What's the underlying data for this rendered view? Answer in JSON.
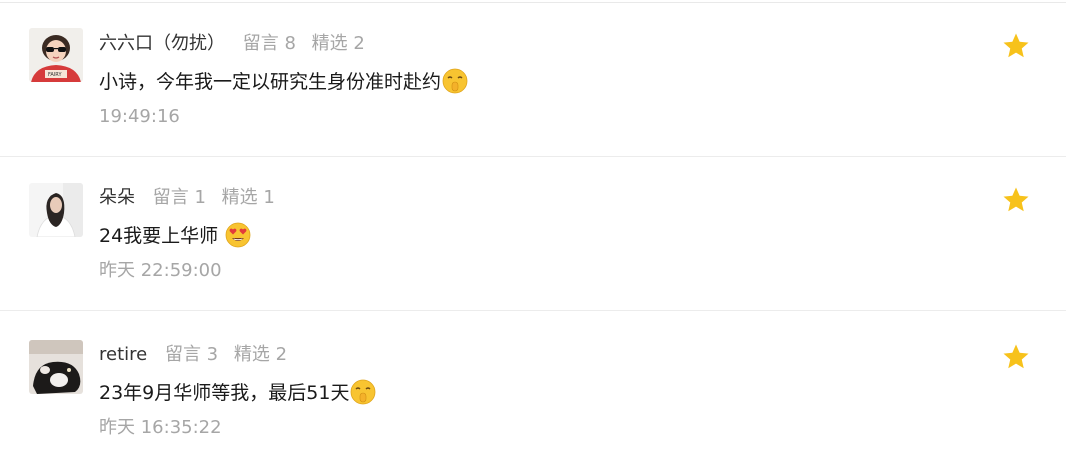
{
  "comments": [
    {
      "nickname": "六六口（勿扰）",
      "reply_count": "留言 8",
      "featured_count": "精选 2",
      "text": "小诗，今年我一定以研究生身份准时赴约",
      "emoji": "shushing-face-emoji",
      "time": "19:49:16",
      "starred": true
    },
    {
      "nickname": "朵朵",
      "reply_count": "留言 1",
      "featured_count": "精选 1",
      "text": "24我要上华师 ",
      "emoji": "heart-eyes-emoji",
      "time": "昨天 22:59:00",
      "starred": true
    },
    {
      "nickname": "retire",
      "reply_count": "留言 3",
      "featured_count": "精选 2",
      "text": "23年9月华师等我，最后51天",
      "emoji": "shushing-face-emoji",
      "time": "昨天 16:35:22",
      "starred": true
    }
  ],
  "colors": {
    "star": "#f7c21b",
    "muted_text": "#a6a6a6",
    "divider": "#ececec"
  }
}
